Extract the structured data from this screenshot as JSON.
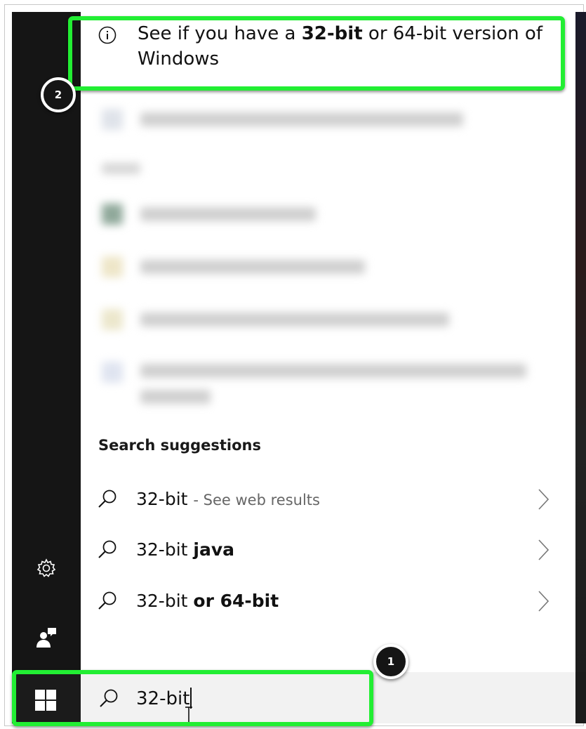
{
  "top_result": {
    "text_before": "See if you have a ",
    "text_bold": "32-bit",
    "text_after": " or 64-bit version of Windows",
    "icon": "info-icon"
  },
  "annotations": {
    "badge_1": "1",
    "badge_2": "2",
    "highlight_color": "#22ee33"
  },
  "search_suggestions": {
    "title": "Search suggestions",
    "items": [
      {
        "query": "32-bit",
        "suffix": "- See web results",
        "suffix_bold": false
      },
      {
        "query": "32-bit",
        "suffix": "java",
        "suffix_bold": true
      },
      {
        "query": "32-bit",
        "suffix": "or 64-bit",
        "suffix_bold": true
      }
    ]
  },
  "search_box": {
    "value": "32-bit",
    "icon": "search-icon"
  },
  "sidebar": {
    "icons": [
      "gear-icon",
      "user-feedback-icon"
    ]
  },
  "taskbar": {
    "start_icon": "windows-logo-icon"
  },
  "colors": {
    "rail": "#151515",
    "panel": "#ffffff",
    "searchbox": "#f2f2f2"
  }
}
